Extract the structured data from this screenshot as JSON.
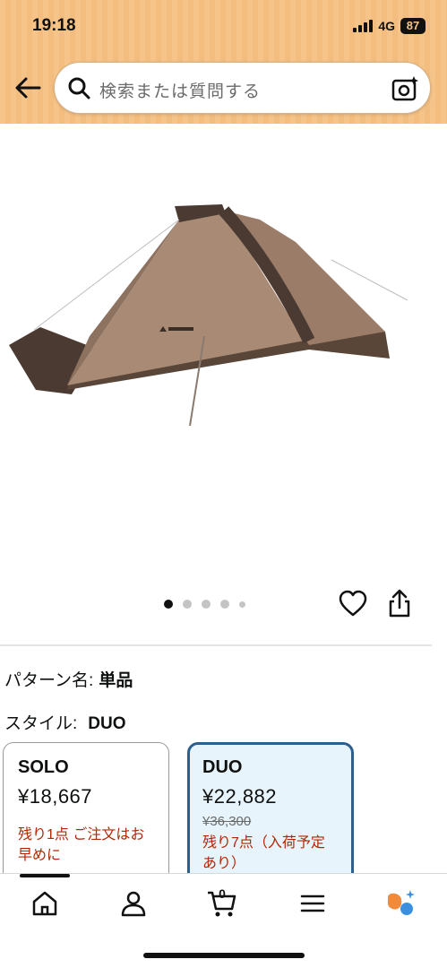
{
  "status_bar": {
    "time": "19:18",
    "network": "4G",
    "battery": "87"
  },
  "search": {
    "placeholder": "検索または質問する"
  },
  "product": {
    "image_dots": 5,
    "active_dot": 0
  },
  "pattern": {
    "label": "パターン名:",
    "value": "単品"
  },
  "style": {
    "label": "スタイル:",
    "value": "DUO"
  },
  "options": [
    {
      "name": "SOLO",
      "price": "¥18,667",
      "list_price": "",
      "stock": "残り1点 ご注文はお早めに",
      "selected": false
    },
    {
      "name": "DUO",
      "price": "¥22,882",
      "list_price": "¥36,300",
      "stock": "残り7点（入荷予定あり）",
      "selected": true
    }
  ],
  "bottom_nav": {
    "cart_count": "0",
    "items": [
      "home-icon",
      "account-icon",
      "cart-icon",
      "menu-icon",
      "rufus-icon"
    ]
  },
  "colors": {
    "header": "#f6c489",
    "selected_border": "#2b5f8e",
    "stock_red": "#b12704"
  }
}
